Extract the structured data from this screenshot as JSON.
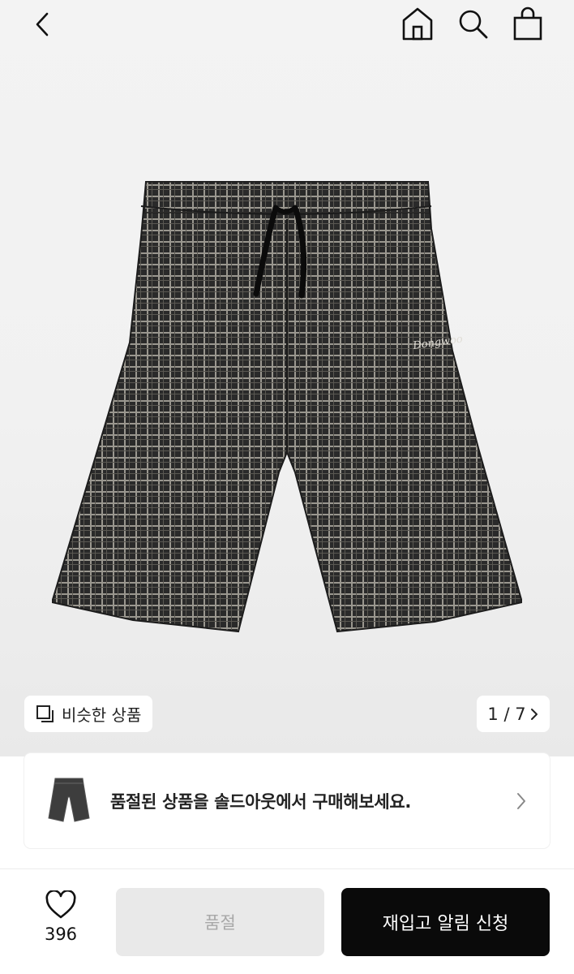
{
  "header": {
    "back_icon": "back-chevron-icon",
    "home_icon": "home-icon",
    "search_icon": "search-icon",
    "cart_icon": "shopping-bag-icon"
  },
  "gallery": {
    "similar_label": "비슷한 상품",
    "similar_icon": "similar-items-icon",
    "page_indicator": "1 / 7",
    "product_image": "black-plaid-shorts"
  },
  "soldout_banner": {
    "text": "품절된 상품을 솔드아웃에서 구매해보세요.",
    "thumb_image": "plaid-shorts-thumbnail",
    "chevron_icon": "chevron-right-icon"
  },
  "bottom_bar": {
    "like_icon": "heart-icon",
    "like_count": "396",
    "soldout_button_label": "품절",
    "restock_button_label": "재입고 알림 신청"
  },
  "colors": {
    "primary_button": "#0a0a0a",
    "disabled_button": "#e9e9e9",
    "disabled_text": "#a8a8a8"
  }
}
